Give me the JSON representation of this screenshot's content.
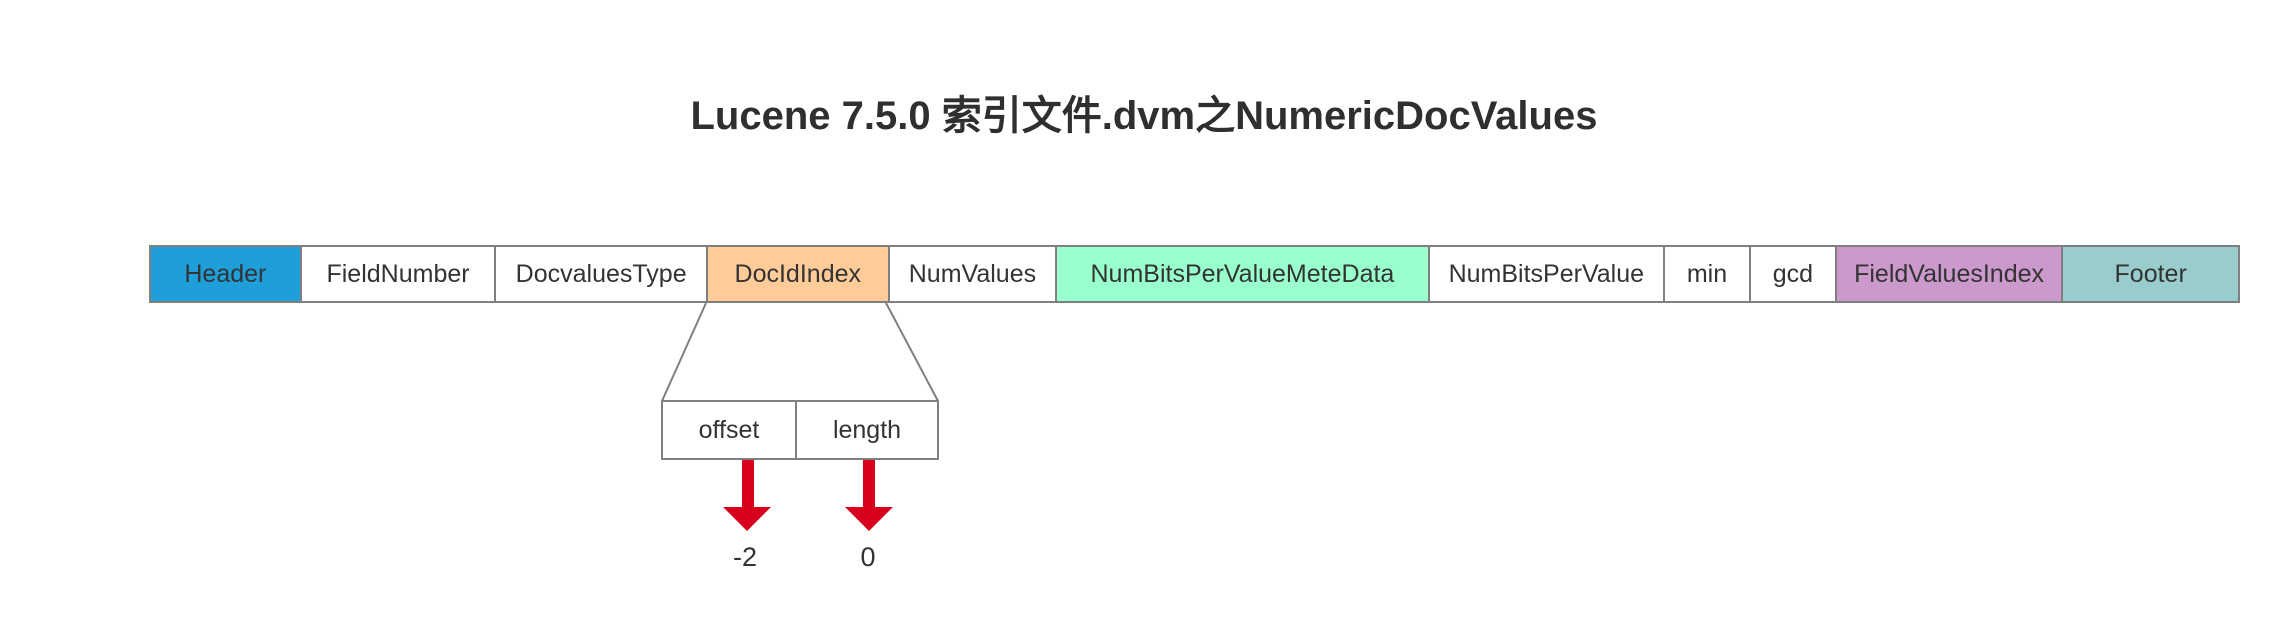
{
  "title": "Lucene 7.5.0 索引文件.dvm之NumericDocValues",
  "fields": [
    {
      "label": "Header",
      "color": "#1f9fd9"
    },
    {
      "label": "FieldNumber",
      "color": "#ffffff"
    },
    {
      "label": "DocvaluesType",
      "color": "#ffffff"
    },
    {
      "label": "DocIdIndex",
      "color": "#ffcc99"
    },
    {
      "label": "NumValues",
      "color": "#ffffff"
    },
    {
      "label": "NumBitsPerValueMeteData",
      "color": "#99ffcc"
    },
    {
      "label": "NumBitsPerValue",
      "color": "#ffffff"
    },
    {
      "label": "min",
      "color": "#ffffff"
    },
    {
      "label": "gcd",
      "color": "#ffffff"
    },
    {
      "label": "FieldValuesIndex",
      "color": "#cc99cc"
    },
    {
      "label": "Footer",
      "color": "#99cccc"
    }
  ],
  "doc_id_index": {
    "offset_label": "offset",
    "length_label": "length",
    "offset_value": "-2",
    "length_value": "0"
  },
  "colors": {
    "arrow": "#d9001b",
    "border": "#7f7f7f"
  }
}
